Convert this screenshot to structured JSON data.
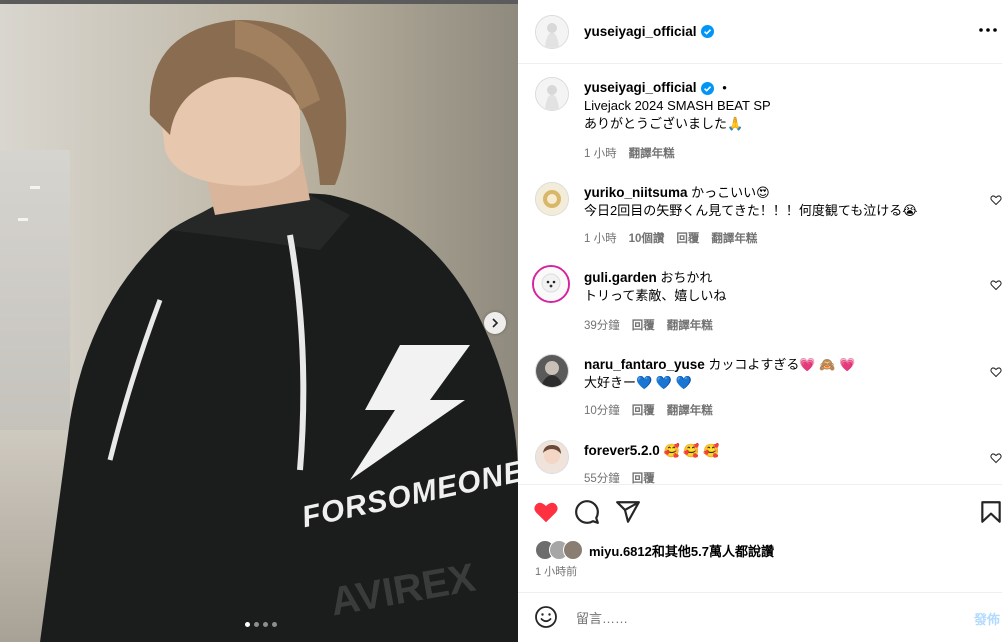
{
  "post": {
    "username": "yuseiyagi_official",
    "caption_line1": "Livejack 2024 SMASH BEAT SP",
    "caption_line2": "ありがとうございました🙏",
    "caption_dot": "•",
    "caption_time": "1 小時",
    "caption_translate": "翻譯年糕"
  },
  "comments": [
    {
      "user": "yuriko_niitsuma",
      "line1": "かっこいい😍",
      "line2": "今日2回目の矢野くん見てきた！！！何度観ても泣ける😭",
      "time": "1 小時",
      "likes": "10個讚",
      "reply": "回覆",
      "translate": "翻譯年糕"
    },
    {
      "user": "guli.garden",
      "line1": "おちかれ",
      "line2": "トリって素敵、嬉しいね",
      "time": "39分鐘",
      "reply": "回覆",
      "translate": "翻譯年糕"
    },
    {
      "user": "naru_fantaro_yuse",
      "line1": "カッコよすぎる💗 🙈 💗",
      "line2": "大好きー💙 💙 💙",
      "time": "10分鐘",
      "reply": "回覆",
      "translate": "翻譯年糕"
    },
    {
      "user": "forever5.2.0",
      "line1": "🥰 🥰 🥰",
      "time": "55分鐘",
      "reply": "回覆"
    }
  ],
  "likes": {
    "text": "miyu.6812和其他5.7萬人都說讚"
  },
  "timestamp": "1 小時前",
  "add_comment": {
    "placeholder": "留言……",
    "post_label": "發佈"
  },
  "photo": {
    "jacket_text_1": "FORSOMEONE",
    "jacket_text_2": "AVIREX",
    "slides": 4,
    "active_slide": 1
  },
  "colors": {
    "heart": "#ff3040",
    "verified": "#0095f6",
    "meta": "#737373"
  },
  "icons": [
    "more-icon",
    "verified-icon",
    "heart-icon",
    "comment-icon",
    "share-icon",
    "save-icon",
    "emoji-icon",
    "next-arrow-icon"
  ]
}
